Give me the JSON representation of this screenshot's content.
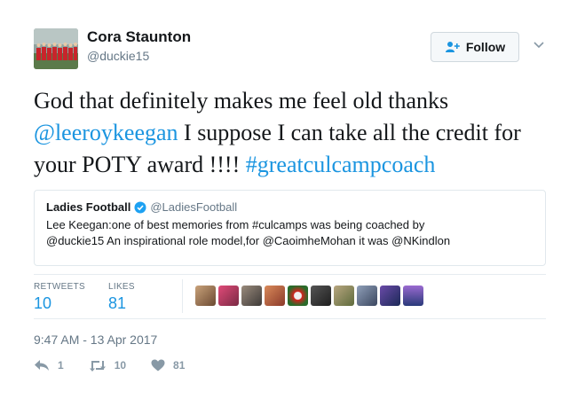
{
  "user": {
    "name": "Cora Staunton",
    "handle": "@duckie15"
  },
  "follow_label": "Follow",
  "tweet": {
    "part1": "God that definitely makes me feel old thanks ",
    "mention": "@leeroykeegan",
    "part2": " I suppose I can take all the credit for your POTY award !!!! ",
    "hashtag": "#greatculcampcoach"
  },
  "quote": {
    "name": "Ladies Football",
    "handle": "@LadiesFootball",
    "line1": "Lee Keegan:one of best memories from #culcamps was being coached by",
    "line2": "@duckie15 An inspirational role model,for @CaoimheMohan it was @NKindlon"
  },
  "stats": {
    "retweets_label": "RETWEETS",
    "retweets": "10",
    "likes_label": "LIKES",
    "likes": "81"
  },
  "timestamp": "9:47 AM - 13 Apr 2017",
  "actions": {
    "reply_count": "1",
    "retweet_count": "10",
    "like_count": "81"
  },
  "colors": {
    "link": "#1b95e0",
    "muted": "#657786",
    "action": "#8899a6"
  },
  "icons": [
    "follow-person-icon",
    "chevron-down-icon",
    "verified-badge-icon",
    "reply-icon",
    "retweet-icon",
    "heart-icon"
  ]
}
